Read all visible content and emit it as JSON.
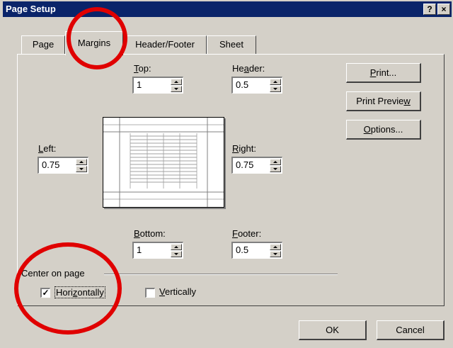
{
  "window": {
    "title": "Page Setup",
    "help_label": "?",
    "close_label": "×"
  },
  "tabs": [
    {
      "label": "Page"
    },
    {
      "label": "Margins"
    },
    {
      "label": "Header/Footer"
    },
    {
      "label": "Sheet"
    }
  ],
  "margins": {
    "top": {
      "label": "Top:",
      "value": "1"
    },
    "header": {
      "label": "Header:",
      "value": "0.5"
    },
    "left": {
      "label": "Left:",
      "value": "0.75"
    },
    "right": {
      "label": "Right:",
      "value": "0.75"
    },
    "bottom": {
      "label": "Bottom:",
      "value": "1"
    },
    "footer": {
      "label": "Footer:",
      "value": "0.5"
    }
  },
  "center_on_page": {
    "label": "Center on page",
    "horizontally": {
      "label": "Horizontally",
      "checked": true
    },
    "vertically": {
      "label": "Vertically",
      "checked": false
    }
  },
  "buttons": {
    "print": "Print...",
    "print_preview": "Print Preview",
    "options": "Options...",
    "ok": "OK",
    "cancel": "Cancel"
  },
  "annotation_color": "#e00000"
}
